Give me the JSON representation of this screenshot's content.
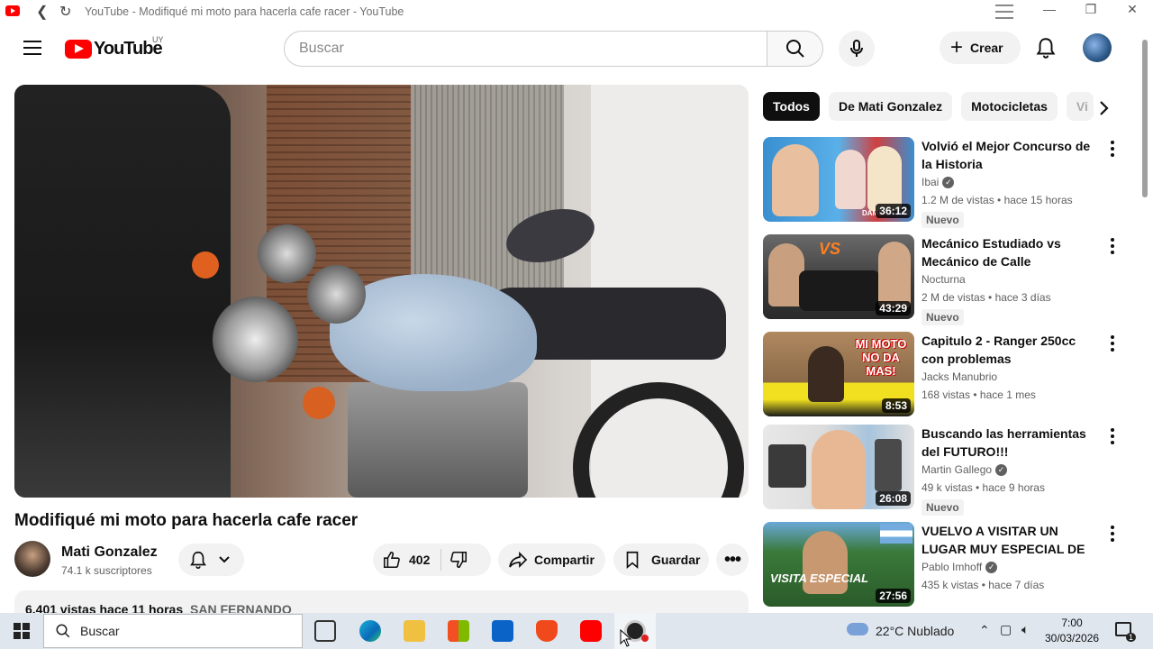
{
  "browser": {
    "window_title": "YouTube - Modifiqué mi moto para hacerla cafe racer - YouTube"
  },
  "header": {
    "logo_text": "YouTube",
    "country_code": "UY",
    "search_placeholder": "Buscar",
    "create_label": "Crear"
  },
  "video": {
    "title": "Modifiqué mi moto para hacerla cafe racer",
    "channel_name": "Mati Gonzalez",
    "subscribers": "74.1 k suscriptores",
    "likes": "402",
    "share_label": "Compartir",
    "save_label": "Guardar",
    "views_time": "6.401 vistas  hace 11 horas",
    "location": "SAN FERNANDO"
  },
  "chips": [
    {
      "label": "Todos",
      "active": true
    },
    {
      "label": "De Mati Gonzalez",
      "active": false
    },
    {
      "label": "Motocicletas",
      "active": false
    },
    {
      "label": "Vi",
      "active": false
    }
  ],
  "recommendations": [
    {
      "title": "Volvió el Mejor Concurso de la Historia",
      "channel": "Ibai",
      "verified": true,
      "meta": "1.2 M de vistas • hace 15 horas",
      "badge": "Nuevo",
      "duration": "36:12",
      "thumb_text": "DAME LA PAS",
      "colors": [
        "#4aa8e0",
        "#c83030"
      ]
    },
    {
      "title": "Mecánico Estudiado vs Mecánico de Calle",
      "channel": "Nocturna",
      "verified": false,
      "meta": "2 M de vistas • hace 3 días",
      "badge": "Nuevo",
      "duration": "43:29",
      "thumb_text": "VS",
      "colors": [
        "#5a5a5a",
        "#2a2a2a"
      ]
    },
    {
      "title": "Capitulo 2 - Ranger 250cc con problemas",
      "channel": "Jacks Manubrio",
      "verified": false,
      "meta": "168 vistas • hace 1 mes",
      "badge": "",
      "duration": "8:53",
      "thumb_text": "MI MOTO NO DA MAS!",
      "colors": [
        "#a07850",
        "#f0e020"
      ]
    },
    {
      "title": "Buscando las herramientas del FUTURO!!!",
      "channel": "Martin Gallego",
      "verified": true,
      "meta": "49 k vistas • hace 9 horas",
      "badge": "Nuevo",
      "duration": "26:08",
      "thumb_text": "",
      "colors": [
        "#e8e8e8",
        "#8ab0d0"
      ]
    },
    {
      "title": "VUELVO A VISITAR UN LUGAR MUY ESPECIAL DE ARGENTIN...",
      "channel": "Pablo Imhoff",
      "verified": true,
      "meta": "435 k vistas • hace 7 días",
      "badge": "",
      "duration": "27:56",
      "thumb_text": "VISITA ESPECIAL",
      "colors": [
        "#3a7a3a",
        "#6aa0d0"
      ]
    }
  ],
  "taskbar": {
    "search_label": "Buscar",
    "weather": "22°C  Nublado",
    "time": "7:00",
    "date": "30/03/2026",
    "notification_count": "1"
  },
  "colors": {
    "brand_red": "#ff0000",
    "text_primary": "#0f0f0f",
    "text_secondary": "#606060",
    "chip_bg": "#f2f2f2"
  }
}
